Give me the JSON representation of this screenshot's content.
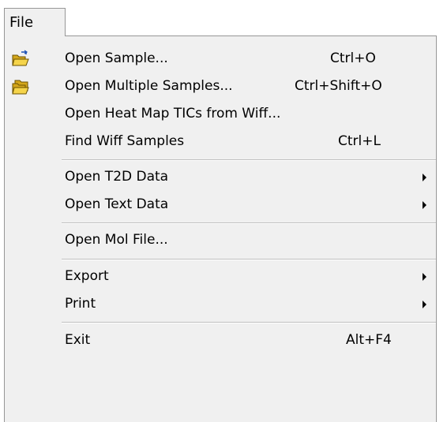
{
  "menubar": {
    "file_label": "File"
  },
  "menu": {
    "items": [
      {
        "label": "Open Sample...",
        "shortcut": "Ctrl+O",
        "icon": "open-folder-icon"
      },
      {
        "label": "Open Multiple Samples...",
        "shortcut": "Ctrl+Shift+O",
        "icon": "open-multiple-folders-icon"
      },
      {
        "label": "Open Heat Map TICs from Wiff...",
        "shortcut": ""
      },
      {
        "label": "Find Wiff Samples",
        "shortcut": "Ctrl+L"
      },
      {
        "label": "Open T2D Data",
        "submenu": true
      },
      {
        "label": "Open Text Data",
        "submenu": true
      },
      {
        "label": "Open Mol File..."
      },
      {
        "label": "Export",
        "submenu": true
      },
      {
        "label": "Print",
        "submenu": true
      },
      {
        "label": "Exit",
        "shortcut": "Alt+F4"
      }
    ]
  },
  "colors": {
    "menu_background": "#f0f0f0",
    "border": "#979797",
    "separator": "#bfbfbf",
    "folder_yellow": "#e8c12e"
  }
}
